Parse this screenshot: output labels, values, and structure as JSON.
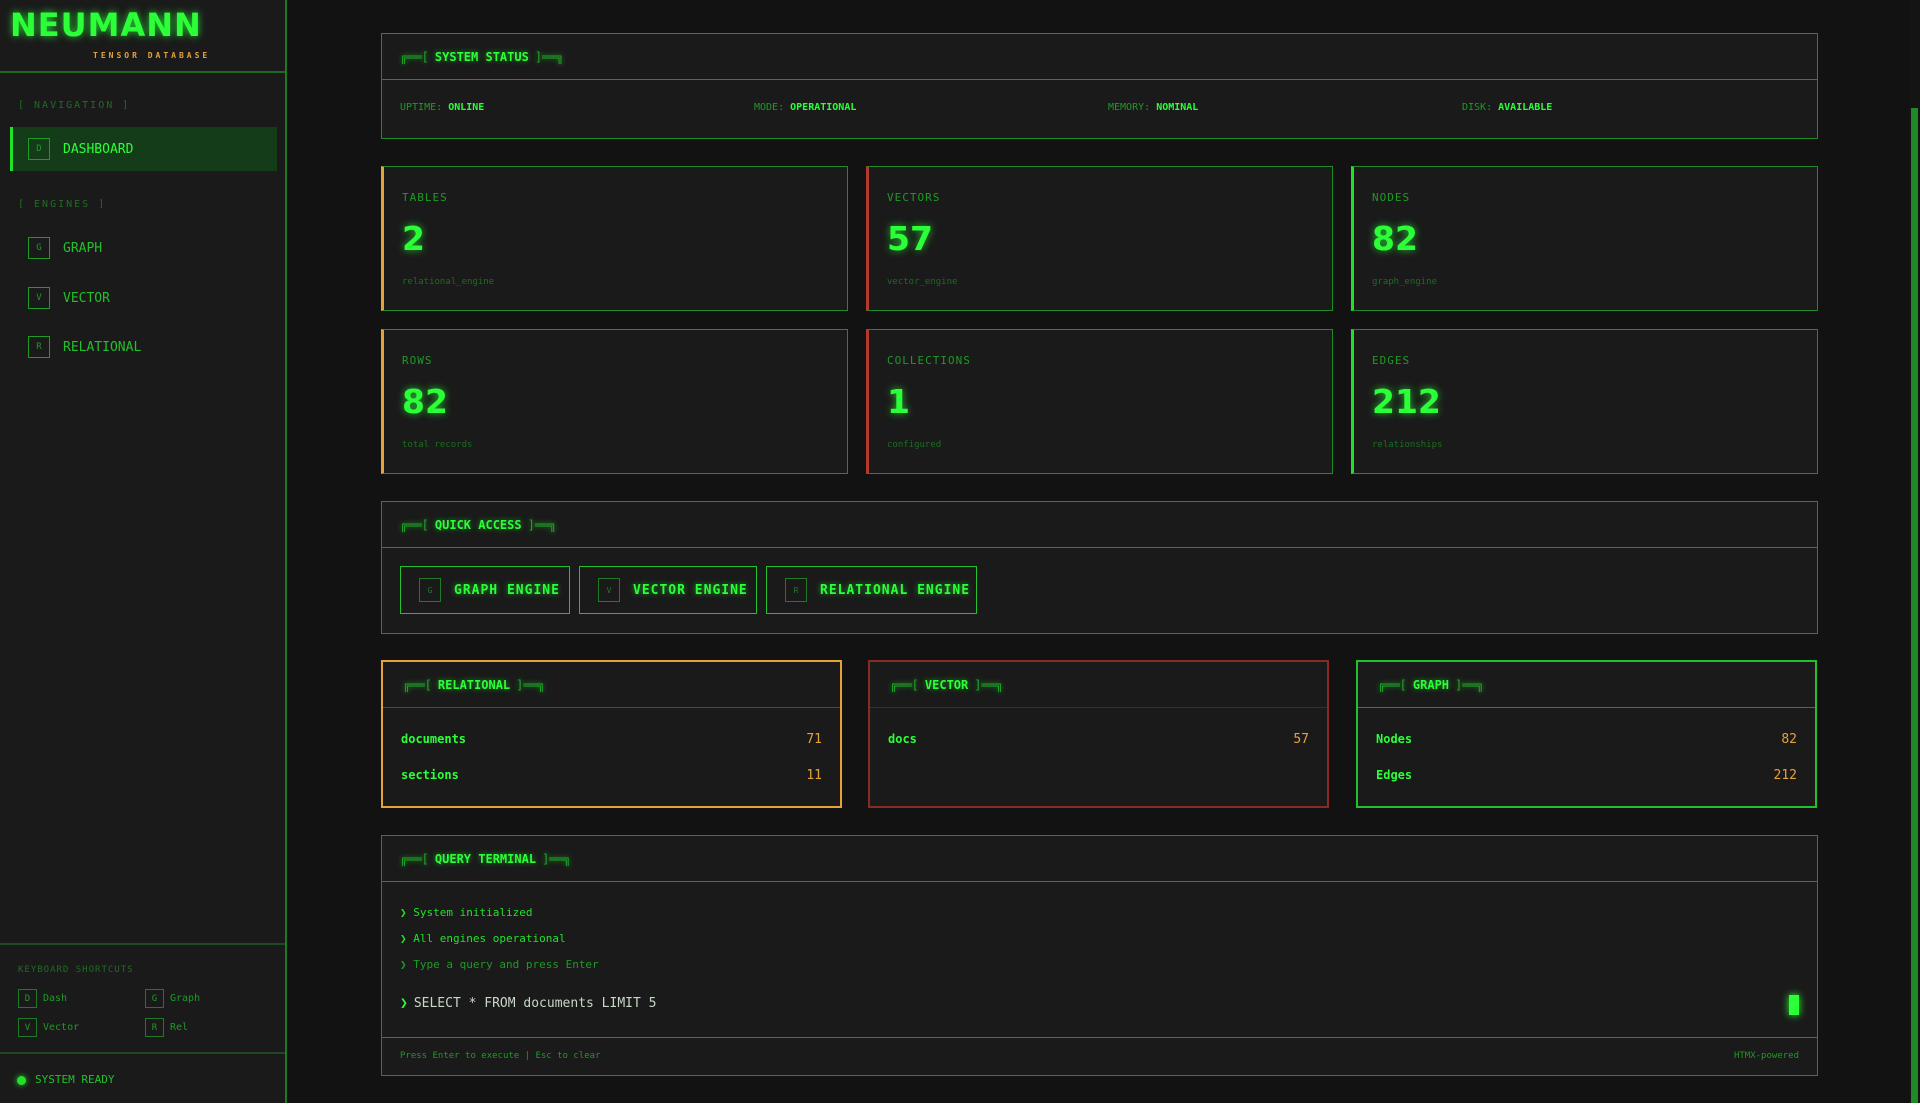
{
  "brand": {
    "name": "NEUMANN",
    "tagline": "TENSOR DATABASE"
  },
  "sidebar": {
    "navigation_title": "[ NAVIGATION ]",
    "engines_title": "[ ENGINES ]",
    "items": [
      {
        "key": "D",
        "label": "DASHBOARD"
      },
      {
        "key": "G",
        "label": "GRAPH"
      },
      {
        "key": "V",
        "label": "VECTOR"
      },
      {
        "key": "R",
        "label": "RELATIONAL"
      }
    ],
    "shortcuts_title": "KEYBOARD SHORTCUTS",
    "shortcuts": [
      {
        "key": "D",
        "label": "Dash"
      },
      {
        "key": "G",
        "label": "Graph"
      },
      {
        "key": "V",
        "label": "Vector"
      },
      {
        "key": "R",
        "label": "Rel"
      }
    ],
    "status": "SYSTEM READY"
  },
  "system_status": {
    "title": "SYSTEM STATUS",
    "items": [
      {
        "label": "UPTIME:",
        "value": "ONLINE"
      },
      {
        "label": "MODE:",
        "value": "OPERATIONAL"
      },
      {
        "label": "MEMORY:",
        "value": "NOMINAL"
      },
      {
        "label": "DISK:",
        "value": "AVAILABLE"
      }
    ]
  },
  "stats": [
    {
      "label": "TABLES",
      "value": "2",
      "sub": "relational_engine"
    },
    {
      "label": "VECTORS",
      "value": "57",
      "sub": "vector_engine"
    },
    {
      "label": "NODES",
      "value": "82",
      "sub": "graph_engine"
    },
    {
      "label": "ROWS",
      "value": "82",
      "sub": "total records"
    },
    {
      "label": "COLLECTIONS",
      "value": "1",
      "sub": "configured"
    },
    {
      "label": "EDGES",
      "value": "212",
      "sub": "relationships"
    }
  ],
  "quick_access": {
    "title": "QUICK ACCESS",
    "buttons": [
      {
        "key": "G",
        "label": "GRAPH ENGINE"
      },
      {
        "key": "V",
        "label": "VECTOR ENGINE"
      },
      {
        "key": "R",
        "label": "RELATIONAL ENGINE"
      }
    ]
  },
  "engines": {
    "relational": {
      "title": "RELATIONAL",
      "rows": [
        {
          "name": "documents",
          "count": "71"
        },
        {
          "name": "sections",
          "count": "11"
        }
      ]
    },
    "vector": {
      "title": "VECTOR",
      "rows": [
        {
          "name": "docs",
          "count": "57"
        }
      ]
    },
    "graph": {
      "title": "GRAPH",
      "rows": [
        {
          "name": "Nodes",
          "count": "82"
        },
        {
          "name": "Edges",
          "count": "212"
        }
      ]
    }
  },
  "terminal": {
    "title": "QUERY TERMINAL",
    "lines": [
      "System initialized",
      "All engines operational",
      "Type a query and press Enter"
    ],
    "prompt": "❯",
    "input_value": "SELECT * FROM documents LIMIT 5",
    "help": "Press Enter to execute | Esc to clear",
    "powered": "HTMX-powered"
  },
  "decor": {
    "bracket_left": "╔══[",
    "bracket_right": "]══╗"
  },
  "colors": {
    "accent": "#22e02a",
    "orange": "#e6a23a",
    "red": "#b33a2a",
    "background": "#121212"
  }
}
